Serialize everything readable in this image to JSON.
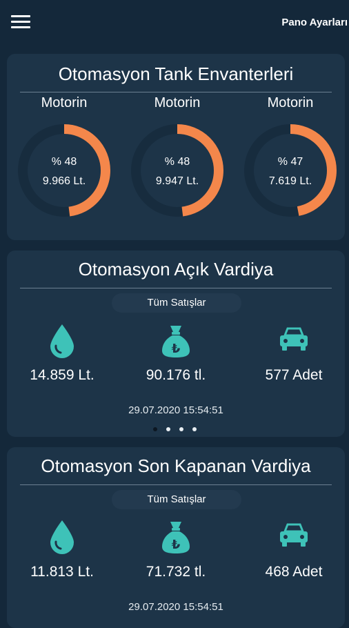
{
  "header": {
    "settings_label": "Pano Ayarları"
  },
  "colors": {
    "accent": "#f4874b",
    "teal": "#3ec2b8",
    "background": "#14283a",
    "card": "#1d3448"
  },
  "tanks_card": {
    "title": "Otomasyon Tank Envanterleri",
    "tanks": [
      {
        "name": "Motorin",
        "percent_label": "%  48",
        "volume": "9.966 Lt.",
        "fill": 0.48
      },
      {
        "name": "Motorin",
        "percent_label": "%  48",
        "volume": "9.947 Lt.",
        "fill": 0.48
      },
      {
        "name": "Motorin",
        "percent_label": "%  47",
        "volume": "7.619 Lt.",
        "fill": 0.47
      }
    ]
  },
  "open_shift": {
    "title": "Otomasyon Açık Vardiya",
    "filter": "Tüm Satışlar",
    "liters": "14.859 Lt.",
    "amount": "90.176 tl.",
    "vehicles": "577 Adet",
    "timestamp": "29.07.2020 15:54:51",
    "page_index": 0,
    "page_count": 4
  },
  "closed_shift": {
    "title": "Otomasyon Son Kapanan Vardiya",
    "filter": "Tüm Satışlar",
    "liters": "11.813 Lt.",
    "amount": "71.732 tl.",
    "vehicles": "468 Adet",
    "timestamp": "29.07.2020 15:54:51"
  },
  "icons": {
    "menu": "hamburger-menu-icon",
    "drop": "fuel-drop-icon",
    "money": "money-bag-lira-icon",
    "car": "car-icon"
  }
}
